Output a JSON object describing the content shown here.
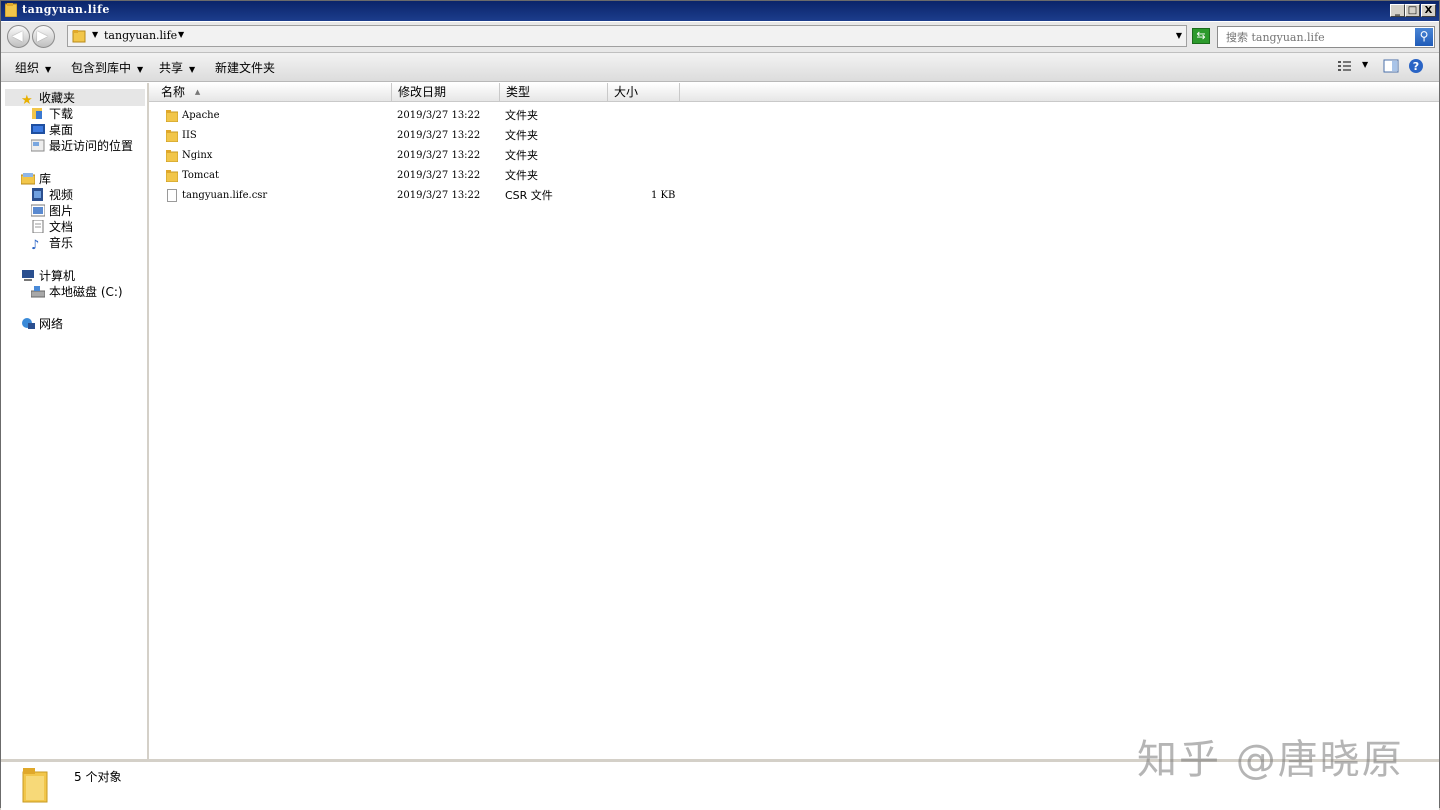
{
  "window": {
    "title": "tangyuan.life",
    "controls": {
      "minimize": "_",
      "maximize": "□",
      "close": "X"
    }
  },
  "address": {
    "crumb": "tangyuan.life",
    "search_placeholder": "搜索 tangyuan.life"
  },
  "toolbar": {
    "organize": "组织",
    "include_in_library": "包含到库中",
    "share": "共享",
    "new_folder": "新建文件夹"
  },
  "nav": {
    "favorites": {
      "label": "收藏夹",
      "items": [
        "下载",
        "桌面",
        "最近访问的位置"
      ]
    },
    "libraries": {
      "label": "库",
      "items": [
        "视频",
        "图片",
        "文档",
        "音乐"
      ]
    },
    "computer": {
      "label": "计算机",
      "items": [
        "本地磁盘 (C:)"
      ]
    },
    "network": {
      "label": "网络"
    }
  },
  "columns": {
    "name": "名称",
    "modified": "修改日期",
    "type": "类型",
    "size": "大小"
  },
  "files": [
    {
      "name": "Apache",
      "modified": "2019/3/27 13:22",
      "type": "文件夹",
      "size": "",
      "kind": "folder"
    },
    {
      "name": "IIS",
      "modified": "2019/3/27 13:22",
      "type": "文件夹",
      "size": "",
      "kind": "folder"
    },
    {
      "name": "Nginx",
      "modified": "2019/3/27 13:22",
      "type": "文件夹",
      "size": "",
      "kind": "folder"
    },
    {
      "name": "Tomcat",
      "modified": "2019/3/27 13:22",
      "type": "文件夹",
      "size": "",
      "kind": "folder"
    },
    {
      "name": "tangyuan.life.csr",
      "modified": "2019/3/27 13:22",
      "type": "CSR 文件",
      "size": "1 KB",
      "kind": "file"
    }
  ],
  "status": {
    "count": "5 个对象"
  },
  "watermark": "知乎 @唐晓原",
  "colors": {
    "titlebar": "#0a246a",
    "folder": "#f2c64a",
    "selection": "#e6e6e6"
  }
}
